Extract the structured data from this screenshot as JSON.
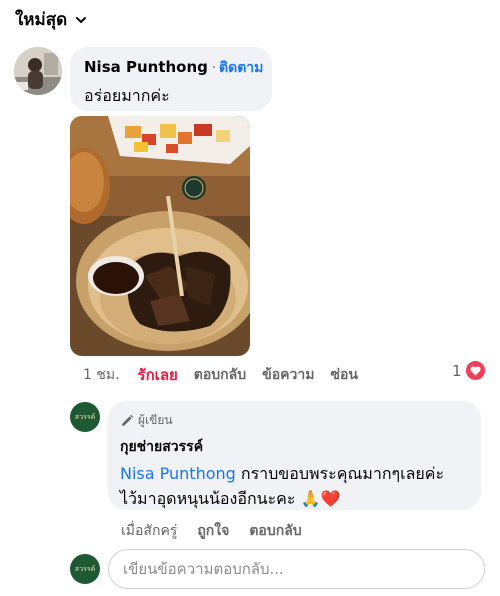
{
  "sort": {
    "label": "ใหม่สุด"
  },
  "comment": {
    "author": "Nisa Punthong",
    "separator": "·",
    "follow_label": "ติดตาม",
    "text": "อร่อยมากค่ะ",
    "time": "1 ชม.",
    "like_label": "รักเลย",
    "reply_label": "ตอบกลับ",
    "message_label": "ข้อความ",
    "hide_label": "ซ่อน",
    "reaction_count": "1"
  },
  "reply": {
    "badge": "ผู้เขียน",
    "author": "กุยช่ายสวรรค์",
    "mention": "Nisa Punthong",
    "text_line1": " กราบขอบพระคุณมากๆเลยค่ะ",
    "text_line2": "ไว้มาอุดหนุนน้องอีกนะคะ",
    "emoji_pray": "🙏",
    "emoji_heart": "❤️",
    "time": "เมื่อสักครู่",
    "like_label": "ถูกใจ",
    "reply_label": "ตอบกลับ"
  },
  "page_avatar_text": "สวรรค์",
  "composer": {
    "placeholder": "เขียนข้อความตอบกลับ..."
  },
  "colors": {
    "link": "#1877f2",
    "love": "#e41e3f",
    "bubble": "#f0f2f5",
    "page_green": "#1d5a33"
  }
}
